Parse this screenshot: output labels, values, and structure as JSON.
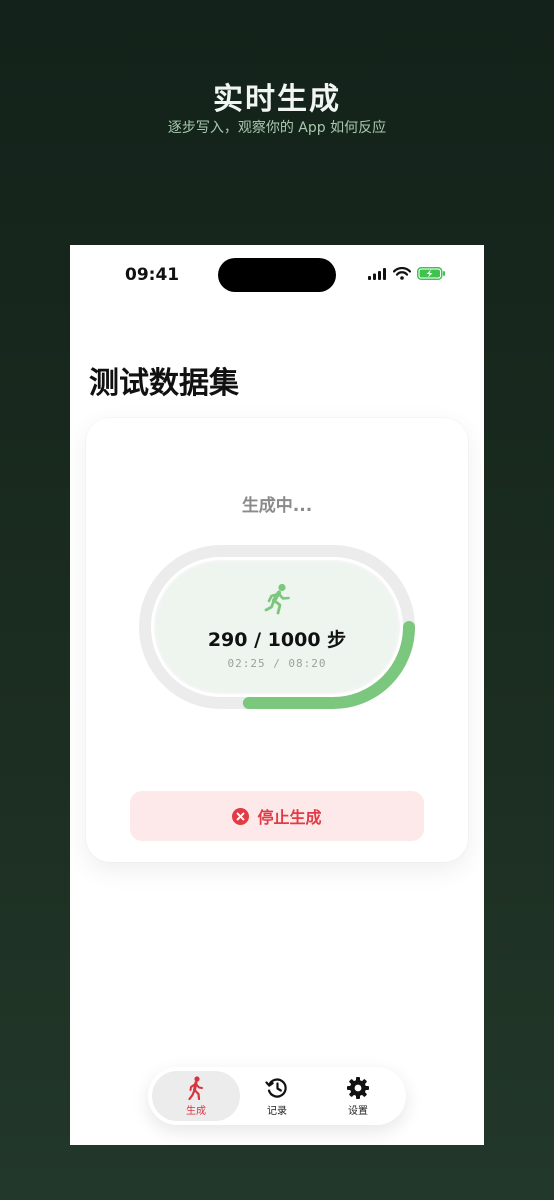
{
  "hero": {
    "title": "实时生成",
    "subtitle": "逐步写入，观察你的 App 如何反应"
  },
  "status_bar": {
    "time": "09:41",
    "icons": [
      "signal-icon",
      "wifi-icon",
      "battery-charging-icon"
    ]
  },
  "page": {
    "title": "测试数据集"
  },
  "progress": {
    "status": "生成中...",
    "steps_text": "290 / 1000 步",
    "time_text": "02:25 / 08:20",
    "fraction": 0.29,
    "icon": "running-person-icon"
  },
  "stop_button": {
    "label": "停止生成",
    "icon": "close-circle-icon"
  },
  "tabs": [
    {
      "label": "生成",
      "icon": "walking-person-icon",
      "active": true
    },
    {
      "label": "记录",
      "icon": "history-icon",
      "active": false
    },
    {
      "label": "设置",
      "icon": "gear-icon",
      "active": false
    }
  ],
  "colors": {
    "accent_green": "#7cc77e",
    "stop_red": "#e23b45",
    "active_tab_red": "#d7343f",
    "background_dark_green": "#13221a"
  }
}
